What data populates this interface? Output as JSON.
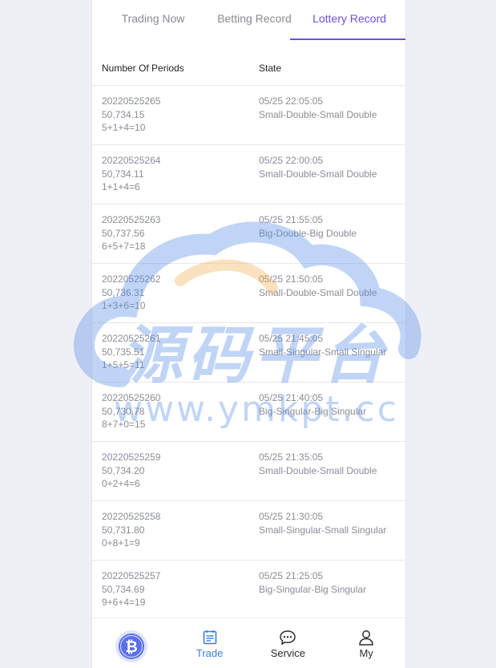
{
  "tabs": [
    {
      "label": "Trading Now",
      "active": false
    },
    {
      "label": "Betting Record",
      "active": false
    },
    {
      "label": "Lottery Record",
      "active": true
    }
  ],
  "table": {
    "headers": {
      "periods": "Number Of Periods",
      "state": "State"
    },
    "rows": [
      {
        "period": "20220525265",
        "value": "50,734.15",
        "sum": "5+1+4=10",
        "time": "05/25 22:05:05",
        "state": "Small-Double-Small Double"
      },
      {
        "period": "20220525264",
        "value": "50,734.11",
        "sum": "1+1+4=6",
        "time": "05/25 22:00:05",
        "state": "Small-Double-Small Double"
      },
      {
        "period": "20220525263",
        "value": "50,737.56",
        "sum": "6+5+7=18",
        "time": "05/25 21:55:05",
        "state": "Big-Double-Big Double"
      },
      {
        "period": "20220525262",
        "value": "50,736.31",
        "sum": "1+3+6=10",
        "time": "05/25 21:50:05",
        "state": "Small-Double-Small Double"
      },
      {
        "period": "20220525261",
        "value": "50,735.51",
        "sum": "1+5+5=11",
        "time": "05/25 21:45:05",
        "state": "Small-Singular-Small Singular"
      },
      {
        "period": "20220525260",
        "value": "50,730.78",
        "sum": "8+7+0=15",
        "time": "05/25 21:40:05",
        "state": "Big-Singular-Big Singular"
      },
      {
        "period": "20220525259",
        "value": "50,734.20",
        "sum": "0+2+4=6",
        "time": "05/25 21:35:05",
        "state": "Small-Double-Small Double"
      },
      {
        "period": "20220525258",
        "value": "50,731.80",
        "sum": "0+8+1=9",
        "time": "05/25 21:30:05",
        "state": "Small-Singular-Small Singular"
      },
      {
        "period": "20220525257",
        "value": "50,734.69",
        "sum": "9+6+4=19",
        "time": "05/25 21:25:05",
        "state": "Big-Singular-Big Singular"
      }
    ]
  },
  "watermark": {
    "title": "源码平台",
    "url": "www.ymkpt.cc"
  },
  "nav": [
    {
      "label": "",
      "icon": "bitcoin-logo-icon",
      "active": false
    },
    {
      "label": "Trade",
      "icon": "document-icon",
      "active": true
    },
    {
      "label": "Service",
      "icon": "chat-icon",
      "active": false
    },
    {
      "label": "My",
      "icon": "user-icon",
      "active": false
    }
  ],
  "colors": {
    "accent": "#6a4fe0",
    "nav_active": "#3a7fdf",
    "watermark": "#5b8fe6"
  }
}
